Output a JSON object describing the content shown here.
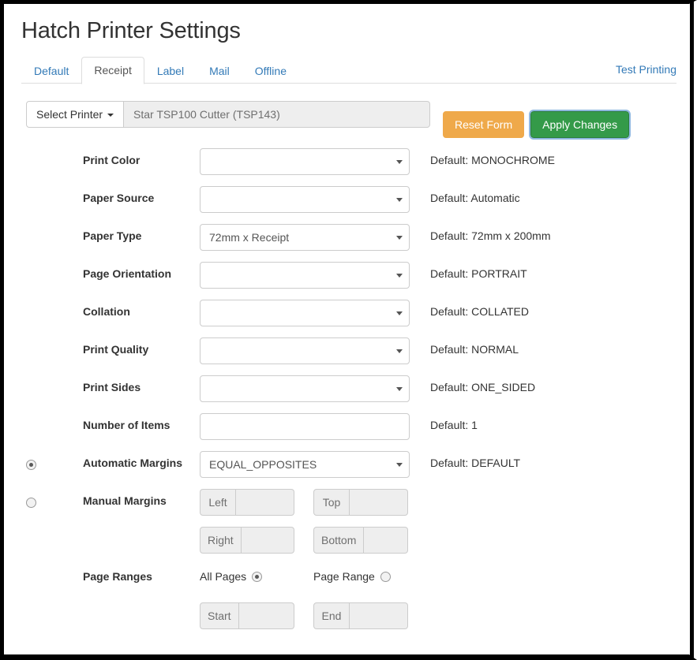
{
  "page_title": "Hatch Printer Settings",
  "tabs": [
    {
      "label": "Default",
      "active": false
    },
    {
      "label": "Receipt",
      "active": true
    },
    {
      "label": "Label",
      "active": false
    },
    {
      "label": "Mail",
      "active": false
    },
    {
      "label": "Offline",
      "active": false
    }
  ],
  "test_printing_link": "Test Printing",
  "printer_bar": {
    "select_printer_label": "Select Printer",
    "selected_printer": "Star TSP100 Cutter (TSP143)"
  },
  "actions": {
    "reset_label": "Reset Form",
    "apply_label": "Apply Changes",
    "reset_color": "#efa94a",
    "apply_color": "#349a49"
  },
  "fields": {
    "print_color": {
      "label": "Print Color",
      "value": "",
      "hint": "Default: MONOCHROME"
    },
    "paper_source": {
      "label": "Paper Source",
      "value": "",
      "hint": "Default: Automatic"
    },
    "paper_type": {
      "label": "Paper Type",
      "value": "72mm x Receipt",
      "hint": "Default: 72mm x 200mm"
    },
    "page_orientation": {
      "label": "Page Orientation",
      "value": "",
      "hint": "Default: PORTRAIT"
    },
    "collation": {
      "label": "Collation",
      "value": "",
      "hint": "Default: COLLATED"
    },
    "print_quality": {
      "label": "Print Quality",
      "value": "",
      "hint": "Default: NORMAL"
    },
    "print_sides": {
      "label": "Print Sides",
      "value": "",
      "hint": "Default: ONE_SIDED"
    },
    "number_of_items": {
      "label": "Number of Items",
      "value": "",
      "placeholder": "",
      "hint": "Default: 1"
    },
    "automatic_margins": {
      "label": "Automatic Margins",
      "value": "EQUAL_OPPOSITES",
      "hint": "Default: DEFAULT",
      "selected": true
    },
    "manual_margins": {
      "label": "Manual Margins",
      "selected": false,
      "left": {
        "addon": "Left",
        "value": ""
      },
      "top": {
        "addon": "Top",
        "value": ""
      },
      "right": {
        "addon": "Right",
        "value": ""
      },
      "bottom": {
        "addon": "Bottom",
        "value": ""
      }
    },
    "page_ranges": {
      "label": "Page Ranges",
      "all_pages_label": "All Pages",
      "all_pages_selected": true,
      "page_range_label": "Page Range",
      "page_range_selected": false,
      "start": {
        "addon": "Start",
        "value": ""
      },
      "end": {
        "addon": "End",
        "value": ""
      }
    }
  }
}
